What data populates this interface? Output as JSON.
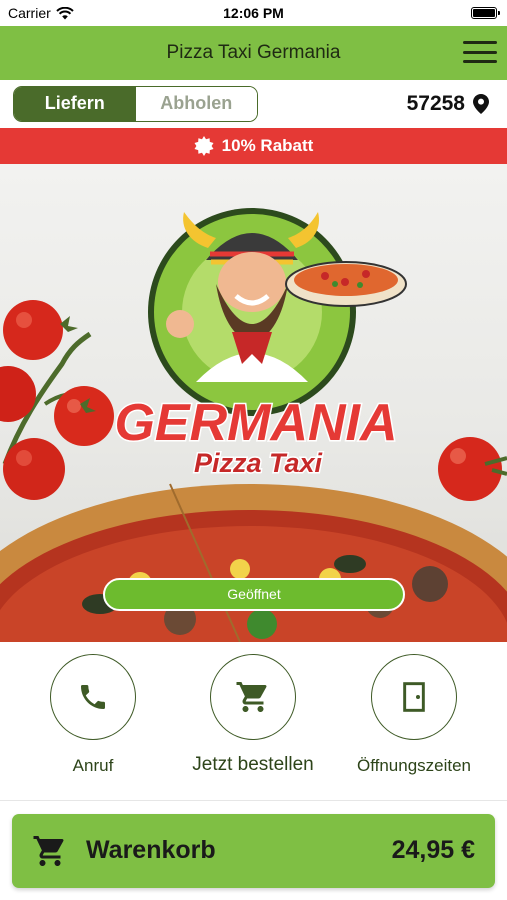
{
  "status_bar": {
    "carrier": "Carrier",
    "time": "12:06 PM"
  },
  "navbar": {
    "title": "Pizza Taxi Germania",
    "menu_icon": "hamburger-menu-icon"
  },
  "mode_toggle": {
    "options": [
      "Liefern",
      "Abholen"
    ],
    "selected": "Liefern"
  },
  "location": {
    "zip": "57258",
    "icon": "location-pin-icon"
  },
  "banner": {
    "text": "10% Rabatt",
    "icon": "badge-icon"
  },
  "hero": {
    "logo_title": "GERMANIA",
    "logo_subtitle": "Pizza Taxi",
    "status_button": "Geöffnet"
  },
  "actions": [
    {
      "label": "Anruf",
      "icon": "phone-icon"
    },
    {
      "label": "Jetzt bestellen",
      "icon": "cart-icon"
    },
    {
      "label": "Öffnungszeiten",
      "icon": "door-icon"
    }
  ],
  "cart": {
    "label": "Warenkorb",
    "total": "24,95 €",
    "icon": "cart-icon"
  },
  "colors": {
    "primary": "#7fbf44",
    "dark_green": "#4a6b2a",
    "banner_red": "#e53935",
    "button_green": "#6dbb2e"
  }
}
